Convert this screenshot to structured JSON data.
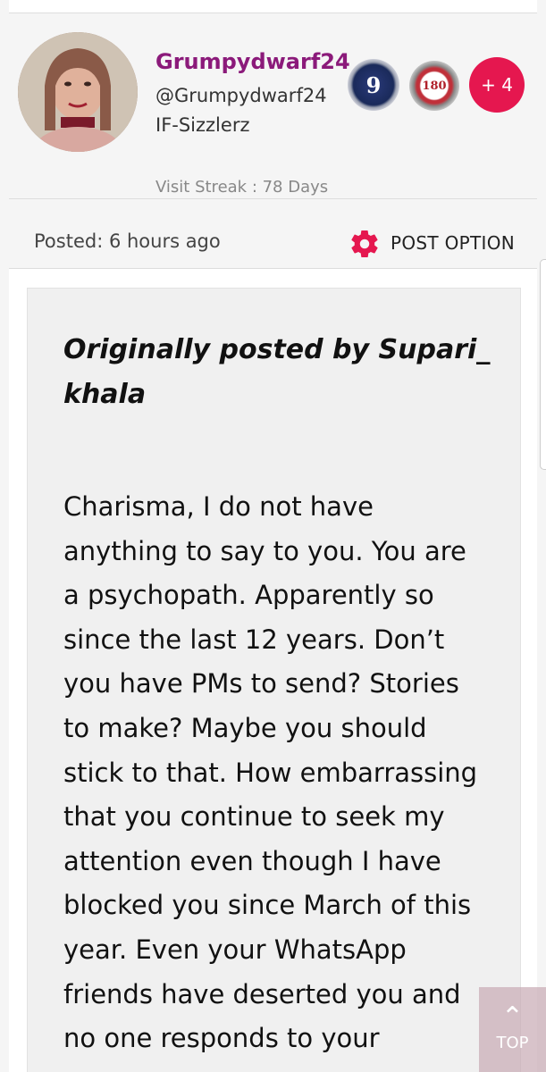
{
  "profile": {
    "username": "Grumpydwarf24",
    "handle": "@Grumpydwarf24",
    "club": "IF-Sizzlerz",
    "badges": {
      "badge_9": "9",
      "badge_180": "180",
      "extra": "+ 4"
    },
    "visit_streak": "Visit Streak : 78 Days"
  },
  "post": {
    "posted": "Posted: 6 hours ago",
    "option_label": "POST OPTION",
    "quote_header": "Originally posted by Supari_khala",
    "quote_body": "Charisma, I do not have anything to say to you. You are a psychopath. Apparently so since the last 12 years. Don’t you have PMs to send? Stories to make? Maybe you should stick to that. How embarrassing that you continue to seek my attention even though I have blocked you since March of this year. Even your WhatsApp friends have deserted you and no one responds to your"
  },
  "nav": {
    "top_label": "TOP"
  },
  "colors": {
    "username": "#8b1a7a",
    "accent": "#e5174f"
  }
}
